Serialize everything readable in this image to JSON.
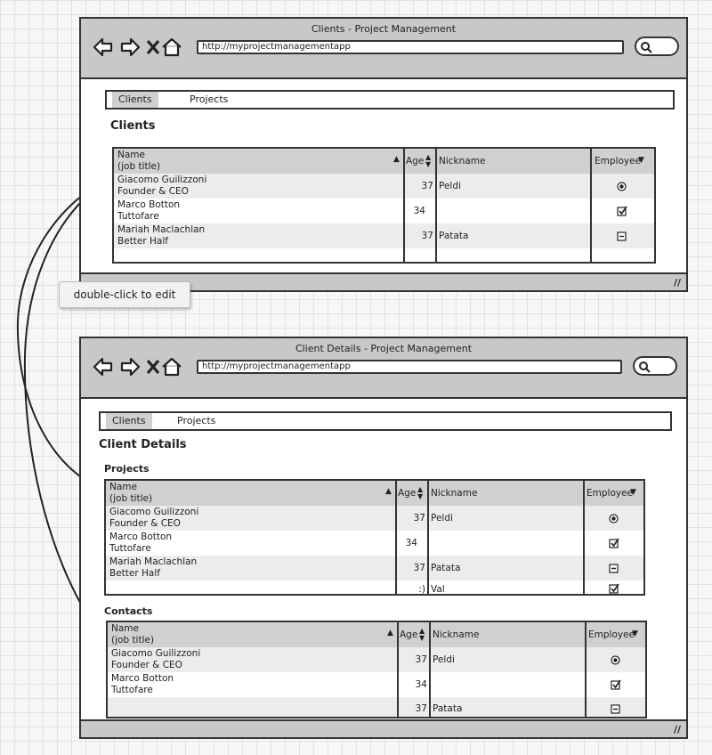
{
  "window1": {
    "title": "Clients - Project Management",
    "url": "http://myprojectmanagementapp",
    "tabs": [
      "Clients",
      "Projects"
    ],
    "heading": "Clients",
    "grid": {
      "columns": {
        "name": "Name",
        "job": "(job title)",
        "age": "Age",
        "nickname": "Nickname",
        "employee": "Employee"
      },
      "rows": [
        {
          "name": "Giacomo Guilizzoni",
          "job": "Founder & CEO",
          "age": "37",
          "nickname": "Peldi",
          "employee": "radio"
        },
        {
          "name": "Marco Botton",
          "job": "Tuttofare",
          "age": "34",
          "nickname": "",
          "employee": "checkbox"
        },
        {
          "name": "Mariah Maclachlan",
          "job": "Better Half",
          "age": "37",
          "nickname": "Patata",
          "employee": "minus"
        }
      ]
    }
  },
  "tooltip": "double-click to edit",
  "window2": {
    "title": "Client Details - Project Management",
    "url": "http://myprojectmanagementapp",
    "tabs": [
      "Clients",
      "Projects"
    ],
    "heading": "Client Details",
    "projects_label": "Projects",
    "contacts_label": "Contacts",
    "projects_grid": {
      "columns": {
        "name": "Name",
        "job": "(job title)",
        "age": "Age",
        "nickname": "Nickname",
        "employee": "Employee"
      },
      "rows": [
        {
          "name": "Giacomo Guilizzoni",
          "job": "Founder & CEO",
          "age": "37",
          "nickname": "Peldi",
          "employee": "radio"
        },
        {
          "name": "Marco Botton",
          "job": "Tuttofare",
          "age": "34",
          "nickname": "",
          "employee": "checkbox"
        },
        {
          "name": "Mariah Maclachlan",
          "job": "Better Half",
          "age": "37",
          "nickname": "Patata",
          "employee": "minus"
        },
        {
          "name": "",
          "job": "",
          "age": ":)",
          "nickname": "Val",
          "employee": "checkbox"
        }
      ]
    },
    "contacts_grid": {
      "columns": {
        "name": "Name",
        "job": "(job title)",
        "age": "Age",
        "nickname": "Nickname",
        "employee": "Employee"
      },
      "rows": [
        {
          "name": "Giacomo Guilizzoni",
          "job": "Founder & CEO",
          "age": "37",
          "nickname": "Peldi",
          "employee": "radio"
        },
        {
          "name": "Marco Botton",
          "job": "Tuttofare",
          "age": "34",
          "nickname": "",
          "employee": "checkbox"
        },
        {
          "name": "",
          "job": "",
          "age": "37",
          "nickname": "Patata",
          "employee": "minus"
        }
      ]
    }
  },
  "icons": {
    "back": "back-arrow-icon",
    "forward": "forward-arrow-icon",
    "stop": "stop-x-icon",
    "home": "home-icon",
    "search": "search-icon",
    "resize": "resize-grip-icon",
    "sort_up": "sort-ascending-icon",
    "sort_both": "sort-both-icon",
    "sort_down": "sort-descending-icon"
  }
}
